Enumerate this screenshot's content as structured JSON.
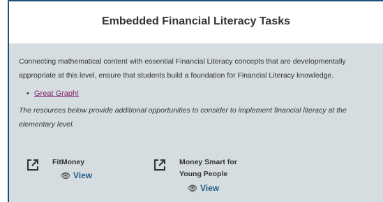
{
  "header": {
    "title": "Embedded Financial Literacy Tasks"
  },
  "intro": "Connecting mathematical content with essential Financial Literacy concepts that are developmentally appropriate at this level, ensure that students build a foundation for Financial Literacy knowledge.",
  "links": [
    {
      "label": "Great Graph!"
    }
  ],
  "note": "The resources below provide additional opportunities to consider to implement financial literacy at the elementary level.",
  "resources": [
    {
      "title": "FitMoney",
      "view_label": "View",
      "icon": "external-link-icon"
    },
    {
      "title": "Money Smart for Young People",
      "view_label": "View",
      "icon": "external-link-icon"
    }
  ],
  "colors": {
    "border": "#1f4e79",
    "panel": "#d6dde1",
    "link": "#7a1f6a",
    "view": "#1f5a86"
  }
}
